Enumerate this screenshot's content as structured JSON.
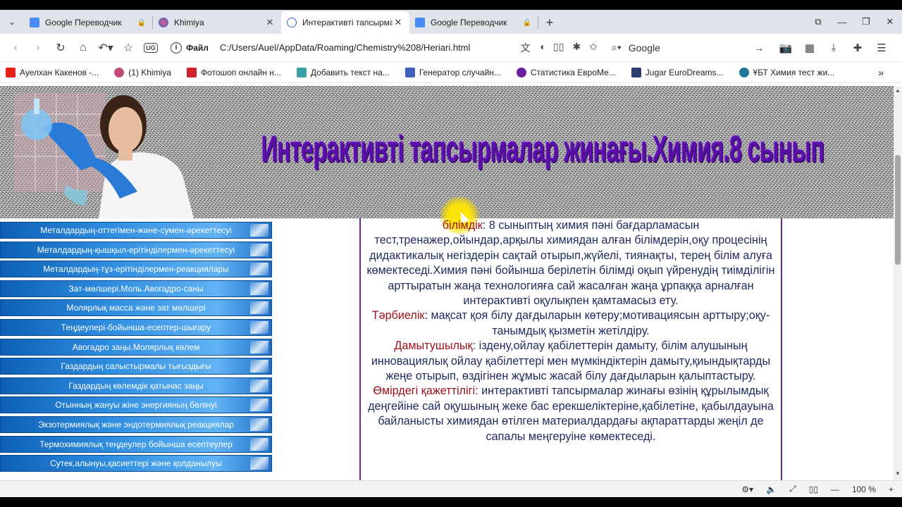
{
  "tabs": [
    {
      "title": "Google Переводчик",
      "active": false,
      "icon": "google-translate-icon",
      "end": "lock"
    },
    {
      "title": "Khimiya",
      "active": false,
      "icon": "khimiya-icon",
      "end": "close"
    },
    {
      "title": "Интерактивті тапсырма",
      "active": true,
      "icon": "globe-icon",
      "end": "close"
    },
    {
      "title": "Google Переводчик",
      "active": false,
      "icon": "google-translate-icon",
      "end": "lock"
    }
  ],
  "address": {
    "scheme": "Файл",
    "url": "C:/Users/Auel/AppData/Roaming/Chemistry%208/Heriari.html"
  },
  "search": {
    "text": "Google"
  },
  "bookmarks": [
    {
      "label": "Ауелхан Какенов -...",
      "icon_color": "#e62117"
    },
    {
      "label": "(1) Khimiya",
      "icon_color": "#c04a7a"
    },
    {
      "label": "Фотошоп онлайн н...",
      "icon_color": "#d2202a"
    },
    {
      "label": "Добавить текст на...",
      "icon_color": "#3aa0a0"
    },
    {
      "label": "Генератор случайн...",
      "icon_color": "#4060c0"
    },
    {
      "label": "Статистика ЕвроМе...",
      "icon_color": "#6a1fa0"
    },
    {
      "label": "Jugar EuroDreams...",
      "icon_color": "#2c3e70"
    },
    {
      "label": "ҰБТ Химия тест жи...",
      "icon_color": "#21759b"
    }
  ],
  "page": {
    "header_title": "Интерактивті тапсырмалар жинағы.Химия.8 сынып",
    "menu": [
      "Металдардың-оттегімен-және-сумен-әрекеттесуі",
      "Металдардың-қышқыл-ерітінділермен-әрекеттесуі",
      "Металдардың-тұз-ерітінділермен-реакциялары",
      "Зат-мөлшері.Моль.Авогадро-саны",
      "Молярлық масса және зат мөлшері",
      "Теңдеулері-бойынша-есептер-шығару",
      "Авогадро заңы.Молярлық көлем",
      "Газдардың салыстырмалы тығыздығы",
      "Газдардың көлемдік қатынас заңы",
      "Отынның жануы жіне энергияның  бөлінуі",
      "Экзотермиялық және эндотермиялық реакциялар",
      "Термохимиялық теңдеулер бойынша есептеулер",
      "Сутек,алынуы,қасиеттері және қолданылуы"
    ],
    "content": {
      "p1_label": "білімдік",
      "p1_text": ": 8 сыныптың химия пәні бағдарламасын тест,тренажер,ойындар,арқылы химиядан алған білімдерін,оқу процесінің дидактикалық негіздерін сақтай отырып,жүйелі, тиянақты, терең білім алуға көмектеседі.Химия пәні бойынша берілетін білімді оқып үйренудің тиімділігін арттыратын жаңа технологияға сай жасалған жаңа ұрпаққа арналған интерактивті оқулықпен қамтамасыз ету.",
      "p2_label": "Тәрбиелік",
      "p2_text": ": мақсат қоя білу дағдыларын көтеру;мотивациясын арттыру;оқу-танымдық қызметін жетілдіру.",
      "p3_label": "Дамытушылық",
      "p3_text": ": іздену,ойлау қабілеттерін дамыту, білім алушының инновациялық ойлау қабілеттері мен мүмкіндіктерін дамыту,қиындықтарды жеңе отырып, өздігінен жұмыс жасай білу дағдыларын қалыптастыру.",
      "p4_label": "Өмірдегі қажеттілігі:",
      "p4_text": " интерактивті тапсырмалар жинағы өзінің құрылымдық деңгейіне сай оқушының жеке бас ерекшеліктеріне,қабілетіне, қабылдауына байланысты  химиядан өтілген материалдардағы ақпараттарды жеңіл де сапалы меңгеруіне көмектеседі."
    }
  },
  "status": {
    "zoom": "100 %"
  }
}
